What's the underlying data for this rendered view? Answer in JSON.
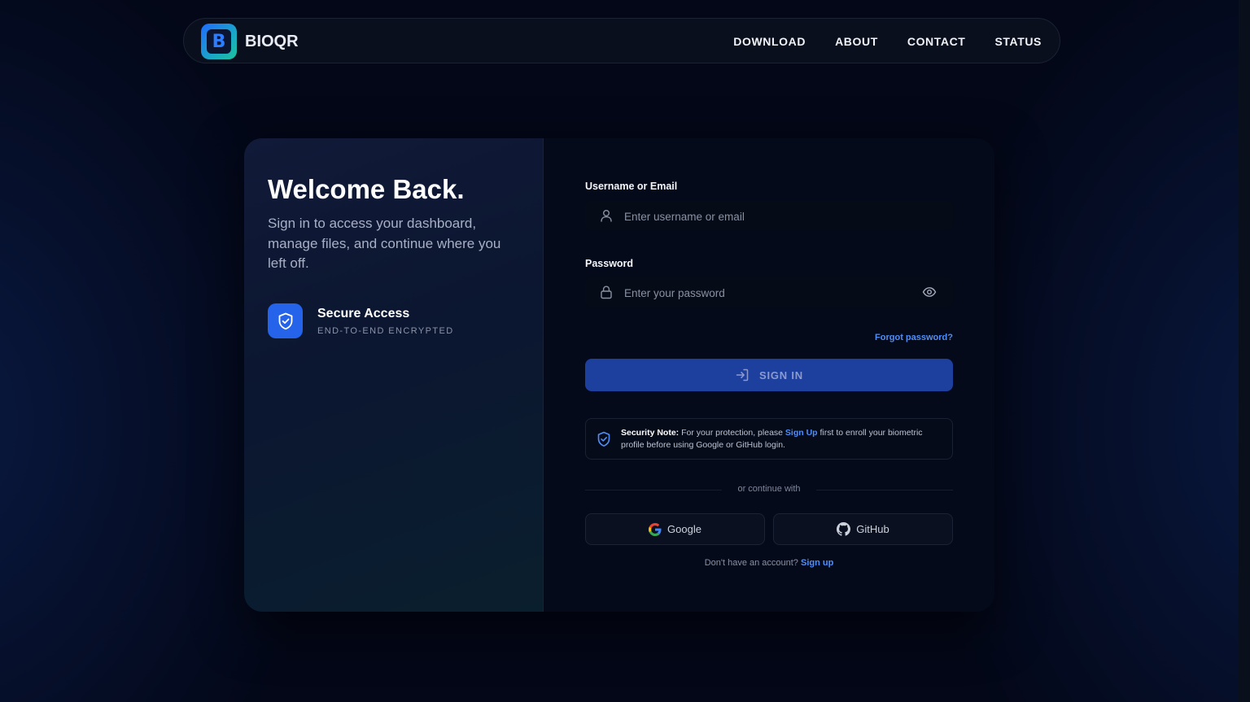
{
  "nav": {
    "brand_letter": "B",
    "brand_name": "BIOQR",
    "links": [
      "DOWNLOAD",
      "ABOUT",
      "CONTACT",
      "STATUS"
    ]
  },
  "welcome": {
    "title": "Welcome Back.",
    "subtitle": "Sign in to access your dashboard, manage files, and continue where you left off.",
    "feature_title": "Secure Access",
    "feature_subtitle": "END-TO-END ENCRYPTED"
  },
  "form": {
    "username_label": "Username or Email",
    "username_placeholder": "Enter username or email",
    "password_label": "Password",
    "password_placeholder": "Enter your password",
    "forgot_label": "Forgot password?",
    "signin_label": "SIGN IN"
  },
  "note": {
    "strong": "Security Note:",
    "text_before": " For your protection, please ",
    "link": "Sign Up",
    "text_after": " first to enroll your biometric profile before using Google or GitHub login."
  },
  "oauth": {
    "divider_text": "or continue with",
    "google_label": "Google",
    "github_label": "GitHub"
  },
  "signup": {
    "prompt": "Don't have an account? ",
    "link": "Sign up"
  },
  "colors": {
    "accent": "#2563eb",
    "link": "#4f8ef7",
    "signin_button": "#1d3f9e",
    "background": "#030717"
  },
  "icons": {
    "user_field": "user-icon",
    "password_field": "lock-icon",
    "password_toggle": "eye-icon",
    "signin": "sign-in-icon",
    "feature": "shield-check-icon",
    "note": "shield-check-icon",
    "google": "google-icon",
    "github": "github-icon"
  }
}
